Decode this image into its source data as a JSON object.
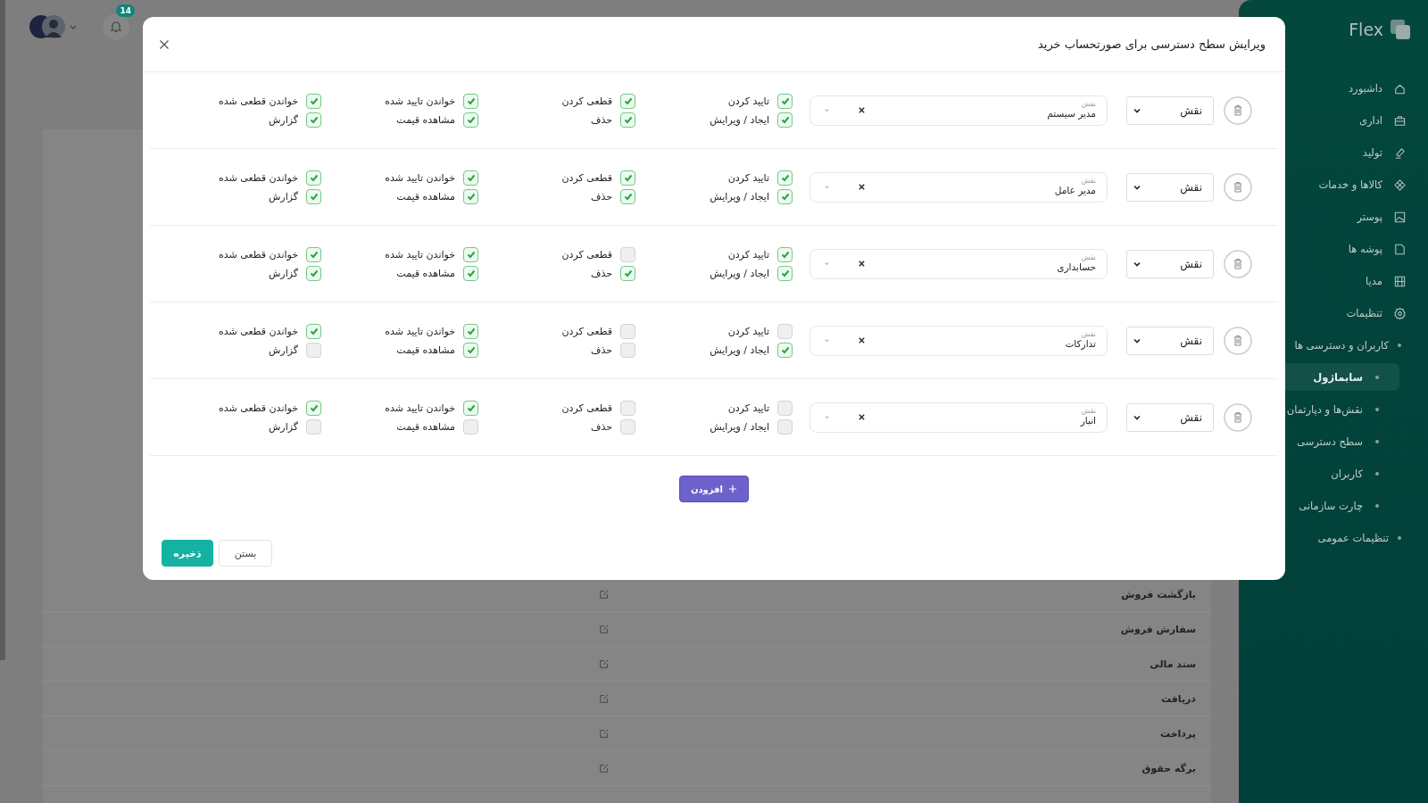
{
  "header": {
    "notification_count": "14"
  },
  "sidebar": {
    "logo": "Flex",
    "items": [
      {
        "label": "داشبورد",
        "kind": "main",
        "selected": false
      },
      {
        "label": "اداری",
        "kind": "main",
        "selected": false
      },
      {
        "label": "تولید",
        "kind": "main",
        "selected": false
      },
      {
        "label": "کالاها و خدمات",
        "kind": "main",
        "selected": false
      },
      {
        "label": "پوستر",
        "kind": "main",
        "selected": false
      },
      {
        "label": "پوشه ها",
        "kind": "main",
        "selected": false
      },
      {
        "label": "مدیا",
        "kind": "main",
        "selected": false
      },
      {
        "label": "تنظیمات",
        "kind": "main",
        "selected": false,
        "children": [
          {
            "label": "کاربران و دسترسی ها",
            "kind": "sub",
            "selected": false,
            "children": [
              {
                "label": "سابماژول",
                "kind": "sub",
                "selected": true
              },
              {
                "label": "نقش‌ها و دپارتمان",
                "kind": "sub",
                "selected": false
              },
              {
                "label": "سطح دسترسی",
                "kind": "sub",
                "selected": false
              },
              {
                "label": "کاربران",
                "kind": "sub",
                "selected": false
              },
              {
                "label": "چارت سازمانی",
                "kind": "sub",
                "selected": false
              }
            ]
          },
          {
            "label": "تنظیمات عمومی",
            "kind": "sub",
            "selected": false
          }
        ]
      }
    ]
  },
  "background_table": {
    "rows": [
      {
        "name": "بازگشت فروش"
      },
      {
        "name": "سفارش فروش"
      },
      {
        "name": "سند مالی"
      },
      {
        "name": "دریافت"
      },
      {
        "name": "پرداخت"
      },
      {
        "name": "برگه حقوق"
      }
    ]
  },
  "dialog": {
    "title": "ویرایش سطح دسترسی برای صورتحساب خرید",
    "rows": [
      {
        "select": "نقش",
        "field_label": "نقش",
        "value": "مدیر سیستم",
        "permissions": [
          {
            "label": "تایید کردن",
            "checked": true
          },
          {
            "label": "قطعی کردن",
            "checked": true
          },
          {
            "label": "خواندن تایید شده",
            "checked": true
          },
          {
            "label": "خواندن قطعی شده",
            "checked": true
          },
          {
            "label": "ایجاد / ویرایش",
            "checked": true
          },
          {
            "label": "حذف",
            "checked": true
          },
          {
            "label": "مشاهده قیمت",
            "checked": true
          },
          {
            "label": "گزارش",
            "checked": true
          }
        ]
      },
      {
        "select": "نقش",
        "field_label": "نقش",
        "value": "مدیر عامل",
        "permissions": [
          {
            "label": "تایید کردن",
            "checked": true
          },
          {
            "label": "قطعی کردن",
            "checked": true
          },
          {
            "label": "خواندن تایید شده",
            "checked": true
          },
          {
            "label": "خواندن قطعی شده",
            "checked": true
          },
          {
            "label": "ایجاد / ویرایش",
            "checked": true
          },
          {
            "label": "حذف",
            "checked": true
          },
          {
            "label": "مشاهده قیمت",
            "checked": true
          },
          {
            "label": "گزارش",
            "checked": true
          }
        ]
      },
      {
        "select": "نقش",
        "field_label": "نقش",
        "value": "حسابداری",
        "permissions": [
          {
            "label": "تایید کردن",
            "checked": true
          },
          {
            "label": "قطعی کردن",
            "checked": false
          },
          {
            "label": "خواندن تایید شده",
            "checked": true
          },
          {
            "label": "خواندن قطعی شده",
            "checked": true
          },
          {
            "label": "ایجاد / ویرایش",
            "checked": true
          },
          {
            "label": "حذف",
            "checked": true
          },
          {
            "label": "مشاهده قیمت",
            "checked": true
          },
          {
            "label": "گزارش",
            "checked": true
          }
        ]
      },
      {
        "select": "نقش",
        "field_label": "نقش",
        "value": "تدارکات",
        "permissions": [
          {
            "label": "تایید کردن",
            "checked": false
          },
          {
            "label": "قطعی کردن",
            "checked": false
          },
          {
            "label": "خواندن تایید شده",
            "checked": true
          },
          {
            "label": "خواندن قطعی شده",
            "checked": true
          },
          {
            "label": "ایجاد / ویرایش",
            "checked": true
          },
          {
            "label": "حذف",
            "checked": false
          },
          {
            "label": "مشاهده قیمت",
            "checked": true
          },
          {
            "label": "گزارش",
            "checked": false
          }
        ]
      },
      {
        "select": "نقش",
        "field_label": "نقش",
        "value": "انبار",
        "permissions": [
          {
            "label": "تایید کردن",
            "checked": false
          },
          {
            "label": "قطعی کردن",
            "checked": false
          },
          {
            "label": "خواندن تایید شده",
            "checked": true
          },
          {
            "label": "خواندن قطعی شده",
            "checked": true
          },
          {
            "label": "ایجاد / ویرایش",
            "checked": false
          },
          {
            "label": "حذف",
            "checked": false
          },
          {
            "label": "مشاهده قیمت",
            "checked": false
          },
          {
            "label": "گزارش",
            "checked": false
          }
        ]
      }
    ],
    "add_button": "افزودن",
    "buttons": [
      {
        "label": "بستن",
        "kind": "secondary"
      },
      {
        "label": "ذخیره",
        "kind": "primary"
      }
    ]
  }
}
